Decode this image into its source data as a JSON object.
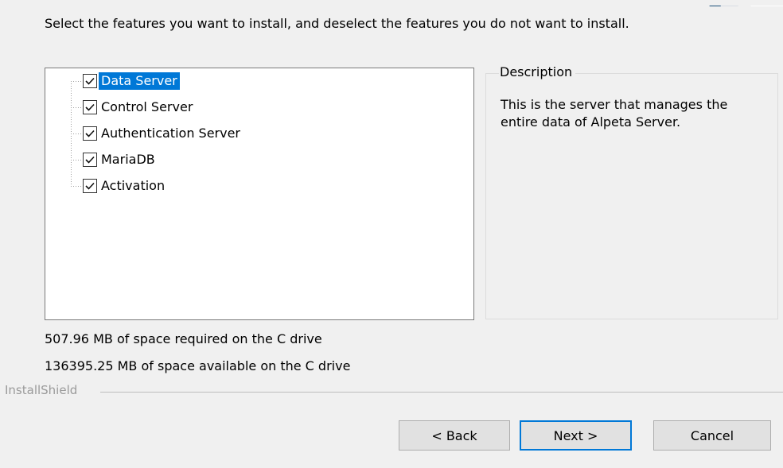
{
  "instruction": "Select the features you want to install, and deselect the features you do not want to install.",
  "features": [
    {
      "label": "Data Server",
      "checked": true,
      "selected": true
    },
    {
      "label": "Control Server",
      "checked": true,
      "selected": false
    },
    {
      "label": "Authentication Server",
      "checked": true,
      "selected": false
    },
    {
      "label": "MariaDB",
      "checked": true,
      "selected": false
    },
    {
      "label": "Activation",
      "checked": true,
      "selected": false
    }
  ],
  "description": {
    "title": "Description",
    "text": "This is the server that manages the entire data of Alpeta Server."
  },
  "space": {
    "required": "507.96 MB of space required on the C drive",
    "available": "136395.25 MB of space available on the C drive"
  },
  "footer": {
    "brand": "InstallShield"
  },
  "buttons": {
    "back": "< Back",
    "next": "Next >",
    "cancel": "Cancel"
  },
  "colors": {
    "selection": "#0078d7",
    "background": "#f0f0f0"
  }
}
